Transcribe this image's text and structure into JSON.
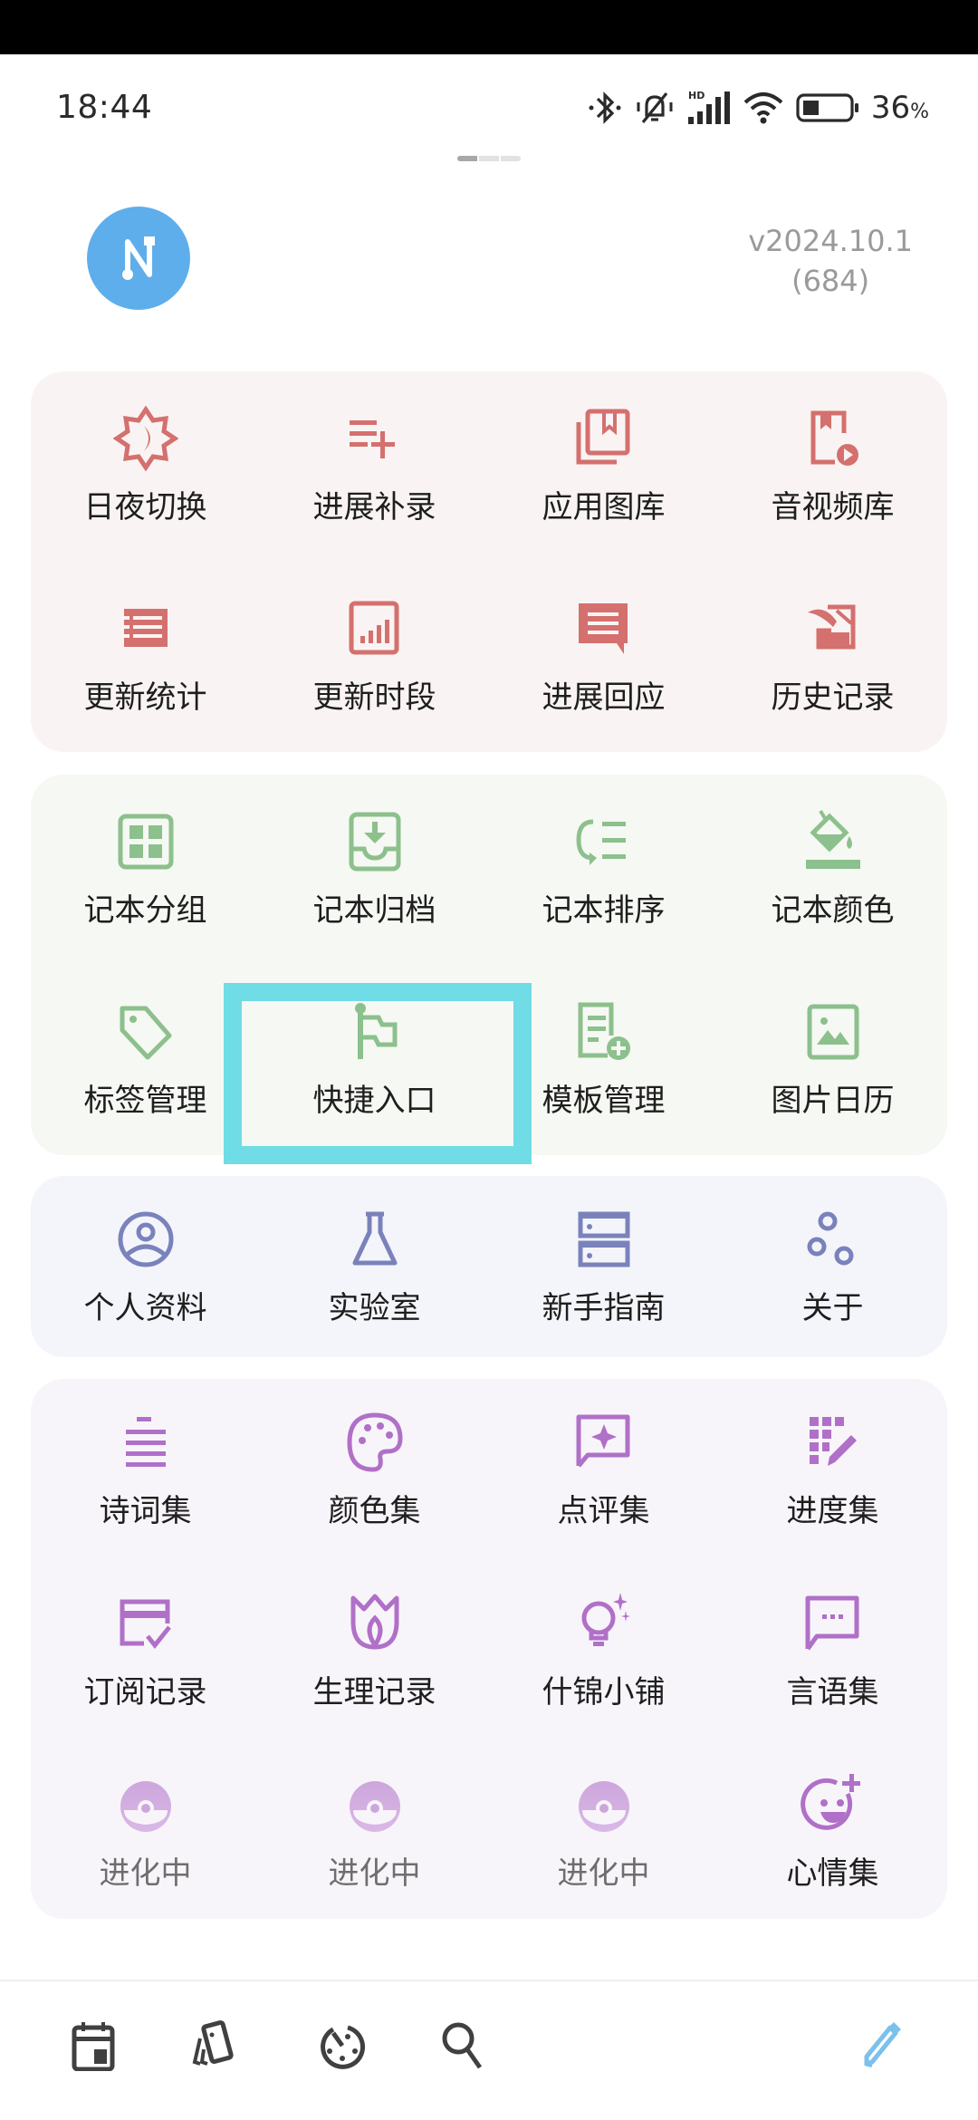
{
  "status_bar": {
    "time": "18:44",
    "icons": [
      "bluetooth-icon",
      "vibrate-silent-icon",
      "hd-signal-icon",
      "wifi-icon",
      "battery-icon"
    ],
    "battery_percent": "36",
    "battery_level": 0.36,
    "percent_sign": "%"
  },
  "pager": {
    "pages": 3,
    "active_index": 0
  },
  "header": {
    "avatar_letter": "N",
    "version": "v2024.10.1",
    "build": "(684)"
  },
  "colors": {
    "red": "#d4706e",
    "green": "#8cc08c",
    "blue": "#7a82bc",
    "purple": "#b070c8",
    "purple_light": "#cfa8dc",
    "highlight": "#6fdce6",
    "avatar": "#5eaeec",
    "edit_accent": "#7cc0ec"
  },
  "sections": [
    {
      "id": "red",
      "items": [
        {
          "label": "日夜切换",
          "icon": "day-night-icon"
        },
        {
          "label": "进展补录",
          "icon": "playlist-add-icon"
        },
        {
          "label": "应用图库",
          "icon": "library-books-icon"
        },
        {
          "label": "音视频库",
          "icon": "media-library-icon"
        },
        {
          "label": "更新统计",
          "icon": "list-table-icon"
        },
        {
          "label": "更新时段",
          "icon": "bar-chart-icon"
        },
        {
          "label": "进展回应",
          "icon": "comment-icon"
        },
        {
          "label": "历史记录",
          "icon": "history-quill-icon"
        }
      ]
    },
    {
      "id": "green",
      "items": [
        {
          "label": "记本分组",
          "icon": "grid-group-icon"
        },
        {
          "label": "记本归档",
          "icon": "archive-icon"
        },
        {
          "label": "记本排序",
          "icon": "sort-icon"
        },
        {
          "label": "记本颜色",
          "icon": "paint-bucket-icon"
        },
        {
          "label": "标签管理",
          "icon": "tag-icon"
        },
        {
          "label": "快捷入口",
          "icon": "flag-icon",
          "highlighted": true
        },
        {
          "label": "模板管理",
          "icon": "template-add-icon"
        },
        {
          "label": "图片日历",
          "icon": "image-icon"
        }
      ]
    },
    {
      "id": "blue",
      "items": [
        {
          "label": "个人资料",
          "icon": "account-circle-icon"
        },
        {
          "label": "实验室",
          "icon": "flask-icon"
        },
        {
          "label": "新手指南",
          "icon": "guide-storage-icon"
        },
        {
          "label": "关于",
          "icon": "about-bubbles-icon"
        }
      ]
    },
    {
      "id": "purple",
      "items": [
        {
          "label": "诗词集",
          "icon": "poem-lines-icon"
        },
        {
          "label": "颜色集",
          "icon": "palette-icon"
        },
        {
          "label": "点评集",
          "icon": "review-sparkle-icon"
        },
        {
          "label": "进度集",
          "icon": "progress-edit-icon"
        },
        {
          "label": "订阅记录",
          "icon": "subscription-card-icon"
        },
        {
          "label": "生理记录",
          "icon": "tulip-icon"
        },
        {
          "label": "什锦小铺",
          "icon": "lightbulb-sparkle-icon"
        },
        {
          "label": "言语集",
          "icon": "chat-dots-icon"
        },
        {
          "label": "进化中",
          "icon": "pokeball-icon",
          "dim": true
        },
        {
          "label": "进化中",
          "icon": "pokeball-icon",
          "dim": true
        },
        {
          "label": "进化中",
          "icon": "pokeball-icon",
          "dim": true
        },
        {
          "label": "心情集",
          "icon": "mood-add-icon"
        }
      ]
    }
  ],
  "bottom_nav": [
    {
      "name": "calendar",
      "icon": "calendar-icon"
    },
    {
      "name": "cards",
      "icon": "cards-icon"
    },
    {
      "name": "timer",
      "icon": "timer-icon"
    },
    {
      "name": "search",
      "icon": "search-icon"
    },
    {
      "name": "edit",
      "icon": "pencil-icon"
    }
  ]
}
